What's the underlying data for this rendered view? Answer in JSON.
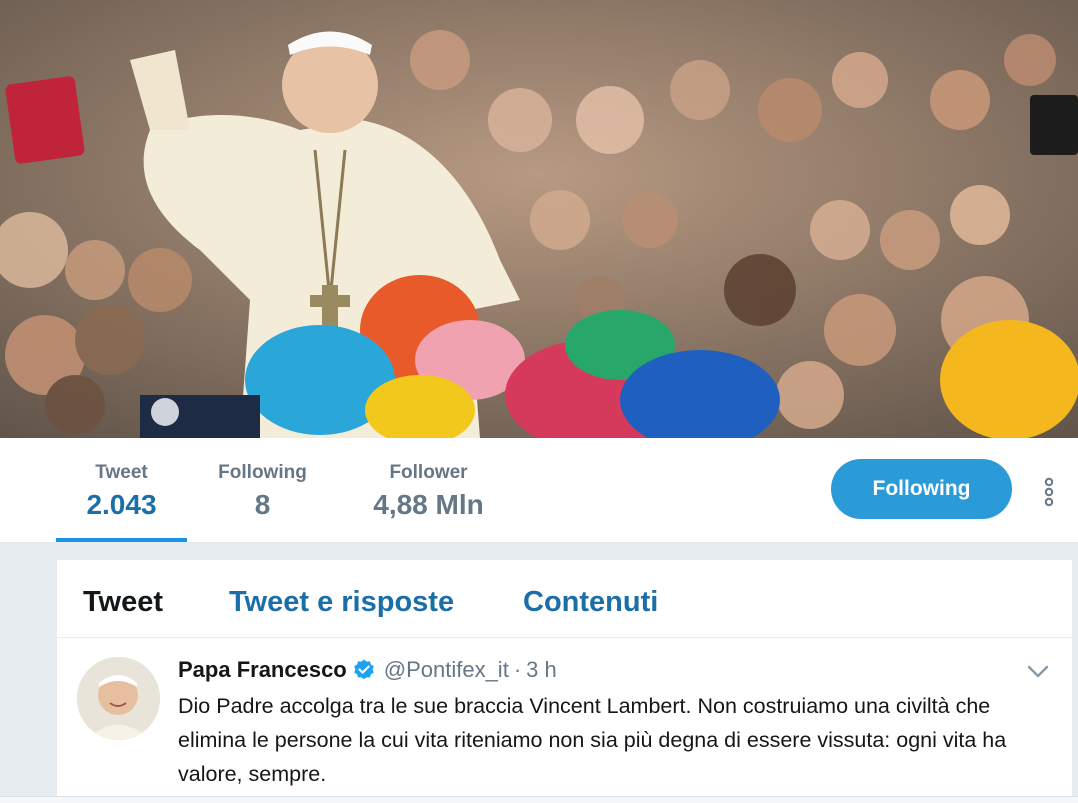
{
  "profile_nav": {
    "stats": [
      {
        "label": "Tweet",
        "value": "2.043"
      },
      {
        "label": "Following",
        "value": "8"
      },
      {
        "label": "Follower",
        "value": "4,88 Mln"
      }
    ],
    "follow_button": "Following",
    "more_icon": "vertical-dots-icon"
  },
  "timeline": {
    "tabs": [
      {
        "label": "Tweet"
      },
      {
        "label": "Tweet e risposte"
      },
      {
        "label": "Contenuti"
      }
    ],
    "tweet": {
      "author_name": "Papa Francesco",
      "author_handle": "@Pontifex_it",
      "separator": "·",
      "time": "3 h",
      "text": "Dio Padre accolga tra le sue braccia Vincent Lambert. Non costruiamo una civiltà che elimina le persone la cui vita riteniamo non sia più degna di essere vissuta: ogni vita ha valore, sempre."
    }
  },
  "colors": {
    "accent": "#1da1f2",
    "link": "#1b6ea7",
    "follow_button": "#2b9bd8",
    "muted": "#657786",
    "background": "#e6ecf0"
  }
}
